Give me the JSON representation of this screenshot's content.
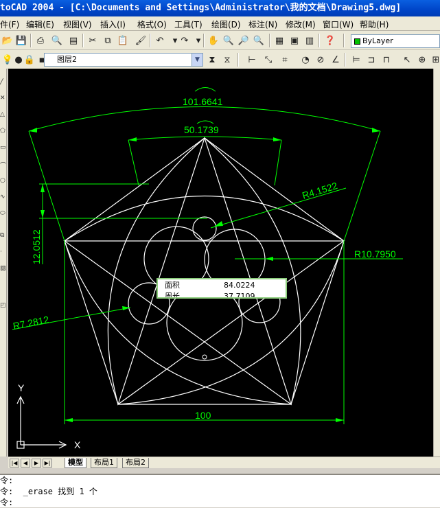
{
  "window": {
    "title": "toCAD 2004 - [C:\\Documents and Settings\\Administrator\\我的文档\\Drawing5.dwg]"
  },
  "menu": {
    "items": [
      "件(F)",
      "编辑(E)",
      "视图(V)",
      "插入(I)",
      "格式(O)",
      "工具(T)",
      "绘图(D)",
      "标注(N)",
      "修改(M)",
      "窗口(W)",
      "帮助(H)"
    ]
  },
  "toolbar": {
    "color_combo": "ByLayer",
    "layer_combo": "图层2"
  },
  "drawing": {
    "dimensions": {
      "outer_arc": "101.6641",
      "inner_arc": "50.1739",
      "height": "12.0512",
      "radius_small": "R4.1522",
      "radius_large": "R10.7950",
      "radius_left": "R7.2812",
      "base": "100"
    },
    "ucs": {
      "x_label": "X",
      "y_label": "Y"
    },
    "tooltip": {
      "rows": [
        {
          "label": "面积",
          "value": "84.0224"
        },
        {
          "label": "周长",
          "value": "37.7109"
        }
      ]
    }
  },
  "layout_tabs": [
    "模型",
    "布局1",
    "布局2"
  ],
  "command_lines": [
    "令:",
    "令:  _erase 找到 1 个",
    "令:"
  ],
  "colors": {
    "title_bar": "#0045c8",
    "canvas": "#000000",
    "dimension": "#00ff00",
    "geometry": "#ffffff"
  }
}
